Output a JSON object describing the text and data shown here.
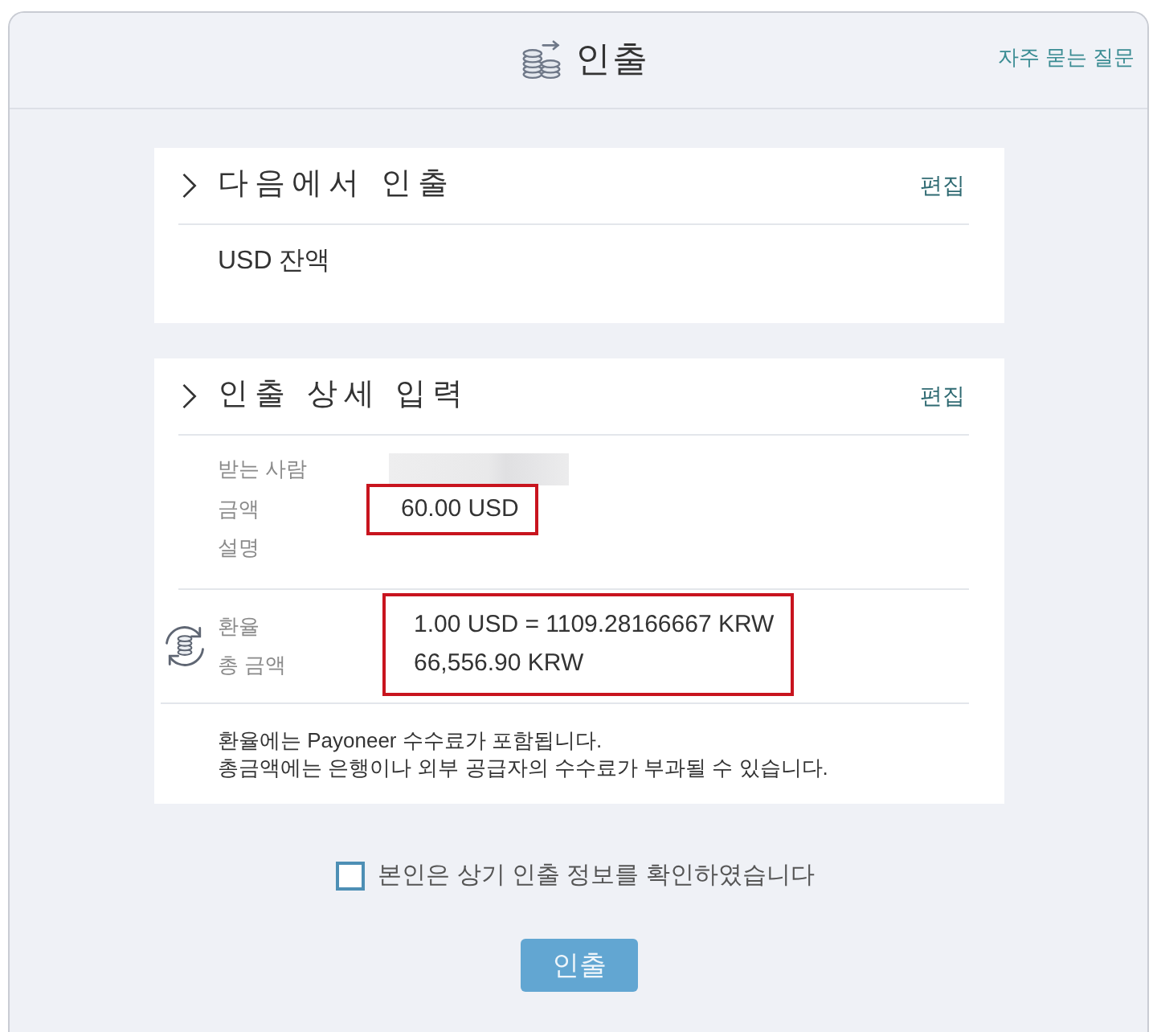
{
  "header": {
    "title": "인출",
    "faq_link": "자주 묻는 질문"
  },
  "source": {
    "title": "다음에서 인출",
    "edit": "편집",
    "value": "USD 잔액"
  },
  "details": {
    "title": "인출 상세 입력",
    "edit": "편집",
    "rows": [
      {
        "label": "받는 사람",
        "redacted": true,
        "highlighted": false
      },
      {
        "label": "금액",
        "value": "60.00 USD",
        "redacted": false,
        "highlighted": true
      },
      {
        "label": "설명",
        "redacted": false,
        "highlighted": false
      }
    ],
    "exchange": {
      "highlighted": true,
      "rows": [
        {
          "label": "환율",
          "value": "1.00 USD = 1109.28166667 KRW"
        },
        {
          "label": "총 금액",
          "value": "66,556.90 KRW"
        }
      ]
    },
    "notes": [
      "환율에는 Payoneer 수수료가 포함됩니다.",
      "총금액에는 은행이나 외부 공급자의 수수료가 부과될 수 있습니다."
    ]
  },
  "confirm": {
    "label": "본인은 상기 인출 정보를 확인하였습니다",
    "checked": false
  },
  "submit": {
    "label": "인출",
    "disabled": true
  }
}
